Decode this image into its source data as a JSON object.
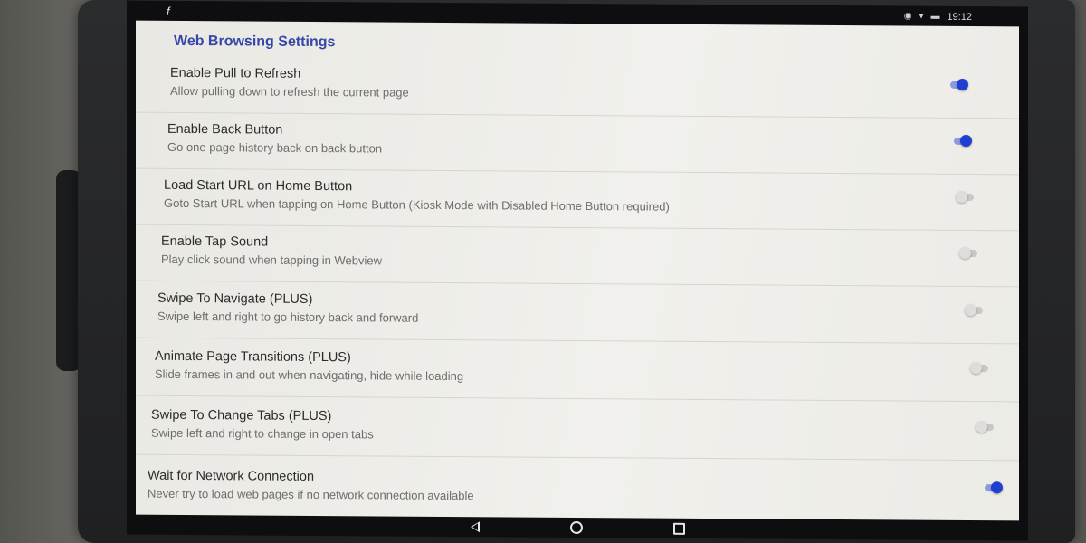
{
  "status_bar": {
    "left_icon": "f",
    "time": "19:12",
    "icons": [
      "location-icon",
      "wifi-icon",
      "battery-icon"
    ]
  },
  "screen": {
    "section_title": "Web Browsing Settings",
    "preferences": [
      {
        "title": "Enable Pull to Refresh",
        "summary": "Allow pulling down to refresh the current page",
        "enabled": true
      },
      {
        "title": "Enable Back Button",
        "summary": "Go one page history back on back button",
        "enabled": true
      },
      {
        "title": "Load Start URL on Home Button",
        "summary": "Goto Start URL when tapping on Home Button (Kiosk Mode with Disabled Home Button required)",
        "enabled": false
      },
      {
        "title": "Enable Tap Sound",
        "summary": "Play click sound when tapping in Webview",
        "enabled": false
      },
      {
        "title": "Swipe To Navigate (PLUS)",
        "summary": "Swipe left and right to go history back and forward",
        "enabled": false
      },
      {
        "title": "Animate Page Transitions (PLUS)",
        "summary": "Slide frames in and out when navigating, hide while loading",
        "enabled": false
      },
      {
        "title": "Swipe To Change Tabs (PLUS)",
        "summary": "Swipe left and right to change in open tabs",
        "enabled": false
      },
      {
        "title": "Wait for Network Connection",
        "summary": "Never try to load web pages if no network connection available",
        "enabled": true
      }
    ]
  },
  "nav_bar": {
    "buttons": [
      "back-icon",
      "home-icon",
      "recents-icon"
    ]
  },
  "colors": {
    "accent": "#3647a9",
    "switch_on": "#1f3fd1",
    "switch_off": "#dedddb"
  }
}
